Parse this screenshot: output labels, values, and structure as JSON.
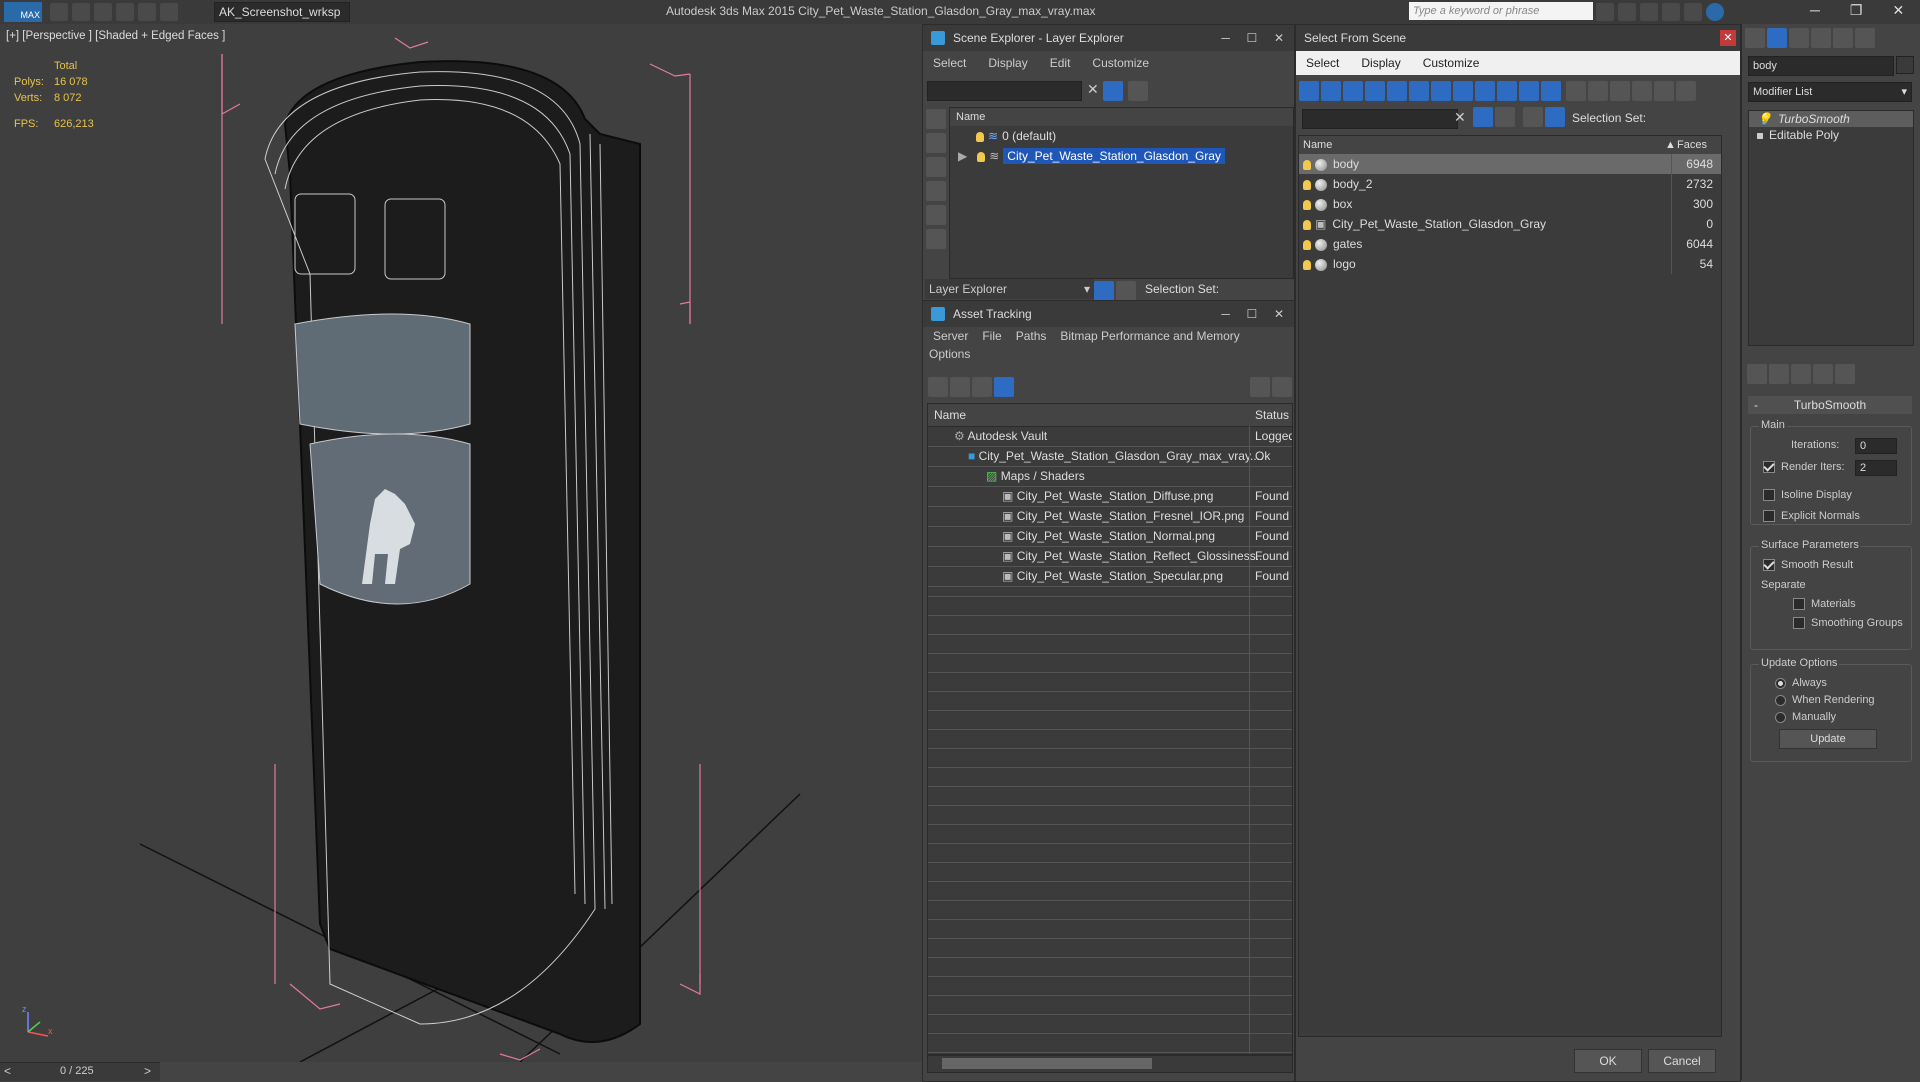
{
  "titlebar": {
    "app_logo": "MAX",
    "workspace": "AK_Screenshot_wrksp",
    "title": "Autodesk 3ds Max  2015    City_Pet_Waste_Station_Glasdon_Gray_max_vray.max",
    "search_placeholder": "Type a keyword or phrase"
  },
  "viewport": {
    "label": "[+] [Perspective ] [Shaded + Edged Faces ]",
    "total_label": "Total",
    "polys_label": "Polys:",
    "polys_value": "16 078",
    "verts_label": "Verts:",
    "verts_value": "8 072",
    "fps_label": "FPS:",
    "fps_value": "626,213",
    "timeline": "0 / 225",
    "prev": "<",
    "next": ">",
    "axis_z": "z",
    "axis_x": "x"
  },
  "scene_explorer": {
    "title": "Scene Explorer - Layer Explorer",
    "menu": [
      "Select",
      "Display",
      "Edit",
      "Customize"
    ],
    "col_name": "Name",
    "layers": [
      {
        "name": "0 (default)"
      },
      {
        "name": "City_Pet_Waste_Station_Glasdon_Gray"
      }
    ],
    "footer_label": "Layer Explorer",
    "selection_set": "Selection Set:"
  },
  "asset_tracking": {
    "title": "Asset Tracking",
    "menu": [
      "Server",
      "File",
      "Paths",
      "Bitmap Performance and Memory"
    ],
    "menu2": "Options",
    "col_name": "Name",
    "col_status": "Status",
    "rows": [
      {
        "name": "Autodesk Vault",
        "status": "Logged"
      },
      {
        "name": "City_Pet_Waste_Station_Glasdon_Gray_max_vray....",
        "status": "Ok"
      },
      {
        "name": "Maps / Shaders",
        "status": ""
      },
      {
        "name": "City_Pet_Waste_Station_Diffuse.png",
        "status": "Found"
      },
      {
        "name": "City_Pet_Waste_Station_Fresnel_IOR.png",
        "status": "Found"
      },
      {
        "name": "City_Pet_Waste_Station_Normal.png",
        "status": "Found"
      },
      {
        "name": "City_Pet_Waste_Station_Reflect_Glossiness...",
        "status": "Found"
      },
      {
        "name": "City_Pet_Waste_Station_Specular.png",
        "status": "Found"
      }
    ]
  },
  "select_from_scene": {
    "title": "Select From Scene",
    "menu": [
      "Select",
      "Display",
      "Customize"
    ],
    "selection_set": "Selection Set:",
    "col_name": "Name",
    "col_faces": "Faces",
    "objects": [
      {
        "name": "body",
        "faces": "6948"
      },
      {
        "name": "body_2",
        "faces": "2732"
      },
      {
        "name": "box",
        "faces": "300"
      },
      {
        "name": "City_Pet_Waste_Station_Glasdon_Gray",
        "faces": "0"
      },
      {
        "name": "gates",
        "faces": "6044"
      },
      {
        "name": "logo",
        "faces": "54"
      }
    ],
    "ok": "OK",
    "cancel": "Cancel"
  },
  "modifier_panel": {
    "object_name": "body",
    "modifier_list": "Modifier List",
    "stack": [
      "TurboSmooth",
      "Editable Poly"
    ],
    "rollout_title": "TurboSmooth",
    "main": "Main",
    "iterations_label": "Iterations:",
    "iterations_value": "0",
    "render_iters_label": "Render Iters:",
    "render_iters_value": "2",
    "isoline": "Isoline Display",
    "explicit_normals": "Explicit Normals",
    "surface_params": "Surface Parameters",
    "smooth_result": "Smooth Result",
    "separate": "Separate",
    "materials": "Materials",
    "smoothing_groups": "Smoothing Groups",
    "update_options": "Update Options",
    "always": "Always",
    "when_rendering": "When Rendering",
    "manually": "Manually",
    "update_btn": "Update"
  }
}
